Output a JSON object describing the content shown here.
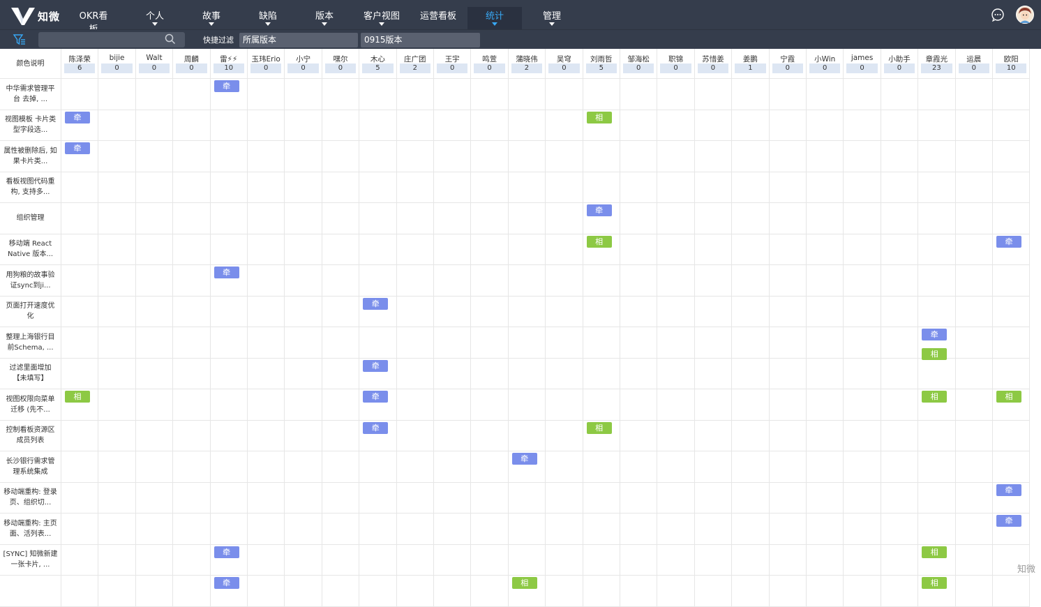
{
  "nav": {
    "logo_text": "知微",
    "items": [
      {
        "label": "OKR看板",
        "caret": false
      },
      {
        "label": "个人",
        "caret": true
      },
      {
        "label": "故事",
        "caret": true
      },
      {
        "label": "缺陷",
        "caret": true
      },
      {
        "label": "版本",
        "caret": true
      },
      {
        "label": "客户视图",
        "caret": true
      },
      {
        "label": "运营看板",
        "caret": false
      },
      {
        "label": "统计",
        "caret": true,
        "active": true
      },
      {
        "label": "管理",
        "caret": true
      }
    ],
    "right_icons": [
      "chat-icon",
      "avatar"
    ]
  },
  "filterbar": {
    "search_placeholder": "",
    "quick_filter_label": "快捷过滤",
    "select1": "所属版本",
    "select2": "0915版本"
  },
  "table": {
    "corner_label": "颜色说明",
    "columns": [
      {
        "name": "陈泽荣",
        "count": "6"
      },
      {
        "name": "bijie",
        "count": "0"
      },
      {
        "name": "Walt",
        "count": "0"
      },
      {
        "name": "周麟",
        "count": "0"
      },
      {
        "name": "雷⚡⚡",
        "count": "10"
      },
      {
        "name": "玉玮Erio",
        "count": "0"
      },
      {
        "name": "小宁",
        "count": "0"
      },
      {
        "name": "嘿尔",
        "count": "0"
      },
      {
        "name": "木心",
        "count": "5"
      },
      {
        "name": "庄广团",
        "count": "2"
      },
      {
        "name": "王宇",
        "count": "0"
      },
      {
        "name": "鸣萱",
        "count": "0"
      },
      {
        "name": "蒲晓伟",
        "count": "2"
      },
      {
        "name": "吴穹",
        "count": "0"
      },
      {
        "name": "刘雨哲",
        "count": "5"
      },
      {
        "name": "邹海松",
        "count": "0"
      },
      {
        "name": "职锦",
        "count": "0"
      },
      {
        "name": "苏惜姜",
        "count": "0"
      },
      {
        "name": "姜鹏",
        "count": "1"
      },
      {
        "name": "宁霞",
        "count": "0"
      },
      {
        "name": "小Win",
        "count": "0"
      },
      {
        "name": "james",
        "count": "0"
      },
      {
        "name": "小助手",
        "count": "0"
      },
      {
        "name": "章霞光",
        "count": "23"
      },
      {
        "name": "运晨",
        "count": "0"
      },
      {
        "name": "欧阳",
        "count": "10"
      }
    ],
    "tag_labels": {
      "qian": "牵",
      "xiang": "相"
    },
    "rows": [
      {
        "label": "中华需求管理平台 去掉, ...",
        "tags": [
          [
            4,
            "qian"
          ]
        ]
      },
      {
        "label": "视图模板 卡片类型字段选...",
        "tags": [
          [
            0,
            "qian"
          ],
          [
            14,
            "xiang"
          ]
        ]
      },
      {
        "label": "属性被删除后, 如果卡片类...",
        "tags": [
          [
            0,
            "qian"
          ]
        ]
      },
      {
        "label": "看板视图代码重构, 支持多...",
        "tags": []
      },
      {
        "label": "组织管理",
        "tags": [
          [
            14,
            "qian"
          ]
        ]
      },
      {
        "label": "移动端 React Native 版本...",
        "tags": [
          [
            14,
            "xiang"
          ],
          [
            25,
            "qian"
          ]
        ]
      },
      {
        "label": "用狗粮的故事验证sync到ji...",
        "tags": [
          [
            4,
            "qian"
          ]
        ]
      },
      {
        "label": "页面打开速度优化",
        "tags": [
          [
            8,
            "qian"
          ]
        ]
      },
      {
        "label": "整理上海银行目前Schema, ...",
        "tags": [
          [
            23,
            "qian"
          ],
          [
            23,
            "xiang",
            1
          ]
        ]
      },
      {
        "label": "过滤里面增加【未填写】",
        "tags": [
          [
            8,
            "qian"
          ]
        ]
      },
      {
        "label": "视图权限向菜单迁移 (先不...",
        "tags": [
          [
            0,
            "xiang"
          ],
          [
            8,
            "qian"
          ],
          [
            23,
            "xiang"
          ],
          [
            25,
            "xiang"
          ]
        ]
      },
      {
        "label": "控制看板资源区成员列表",
        "tags": [
          [
            8,
            "qian"
          ],
          [
            14,
            "xiang"
          ]
        ]
      },
      {
        "label": "长沙银行需求管理系统集成",
        "tags": [
          [
            12,
            "qian"
          ]
        ]
      },
      {
        "label": "移动端重构: 登录页、组织切...",
        "tags": [
          [
            25,
            "qian"
          ]
        ]
      },
      {
        "label": "移动端重构: 主页面、活列表...",
        "tags": [
          [
            25,
            "qian"
          ]
        ]
      },
      {
        "label": "[SYNC] 知微新建一张卡片, ...",
        "tags": [
          [
            4,
            "qian"
          ],
          [
            23,
            "xiang"
          ]
        ]
      },
      {
        "label": "",
        "tags": [
          [
            4,
            "qian"
          ],
          [
            12,
            "xiang"
          ],
          [
            23,
            "xiang"
          ]
        ]
      }
    ]
  },
  "watermark": "知微",
  "colors": {
    "nav_bg": "#353d4c",
    "active": "#38a8f5",
    "qian": "#7a8eeb",
    "xiang": "#8dc944"
  }
}
